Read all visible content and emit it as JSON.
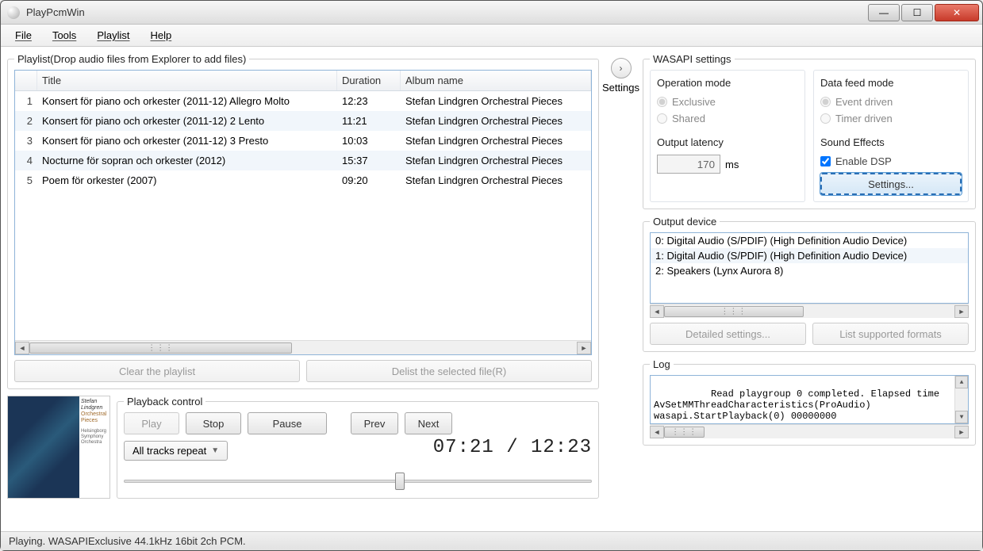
{
  "window": {
    "title": "PlayPcmWin"
  },
  "menu": {
    "file": "File",
    "tools": "Tools",
    "playlist": "Playlist",
    "help": "Help"
  },
  "playlist": {
    "legend": "Playlist(Drop audio files from Explorer to add files)",
    "columns": {
      "title": "Title",
      "duration": "Duration",
      "album": "Album name"
    },
    "rows": [
      {
        "n": "1",
        "title": "Konsert för piano och orkester (2011-12) Allegro Molto",
        "duration": "12:23",
        "album": "Stefan Lindgren Orchestral Pieces"
      },
      {
        "n": "2",
        "title": "Konsert för piano och orkester (2011-12) 2 Lento",
        "duration": "11:21",
        "album": "Stefan Lindgren Orchestral Pieces"
      },
      {
        "n": "3",
        "title": "Konsert för piano och orkester (2011-12) 3 Presto",
        "duration": "10:03",
        "album": "Stefan Lindgren Orchestral Pieces"
      },
      {
        "n": "4",
        "title": "Nocturne för sopran och orkester (2012)",
        "duration": "15:37",
        "album": "Stefan Lindgren Orchestral Pieces"
      },
      {
        "n": "5",
        "title": "Poem för orkester (2007)",
        "duration": "09:20",
        "album": "Stefan Lindgren Orchestral Pieces"
      }
    ],
    "clear_btn": "Clear the playlist",
    "delist_btn": "Delist the selected file(R)"
  },
  "settings_toggle": {
    "label": "Settings"
  },
  "wasapi": {
    "legend": "WASAPI settings",
    "opmode": {
      "title": "Operation mode",
      "exclusive": "Exclusive",
      "shared": "Shared"
    },
    "feedmode": {
      "title": "Data feed mode",
      "event": "Event driven",
      "timer": "Timer driven"
    },
    "latency": {
      "title": "Output latency",
      "value": "170",
      "unit": "ms"
    },
    "sfx": {
      "title": "Sound Effects",
      "enable": "Enable DSP",
      "settings": "Settings..."
    }
  },
  "output": {
    "legend": "Output device",
    "devices": [
      "0: Digital Audio (S/PDIF) (High Definition Audio Device)",
      "1: Digital Audio (S/PDIF) (High Definition Audio Device)",
      "2: Speakers (Lynx Aurora 8)"
    ],
    "detailed": "Detailed settings...",
    "list_formats": "List supported formats"
  },
  "log": {
    "legend": "Log",
    "lines": "Read playgroup 0 completed. Elapsed time\nAvSetMMThreadCharacteristics(ProAudio) \nwasapi.StartPlayback(0) 00000000"
  },
  "playback": {
    "legend": "Playback control",
    "play": "Play",
    "stop": "Stop",
    "pause": "Pause",
    "prev": "Prev",
    "next": "Next",
    "repeat": "All tracks repeat",
    "time": "07:21 / 12:23",
    "progress_pct": 59
  },
  "cover": {
    "line1": "Stefan",
    "line2": "Lindgren",
    "line3": "Orchestral",
    "line4": "Pieces",
    "credits": "Helsingborg Symphony Orchestra"
  },
  "status": "Playing. WASAPIExclusive 44.1kHz 16bit 2ch PCM."
}
